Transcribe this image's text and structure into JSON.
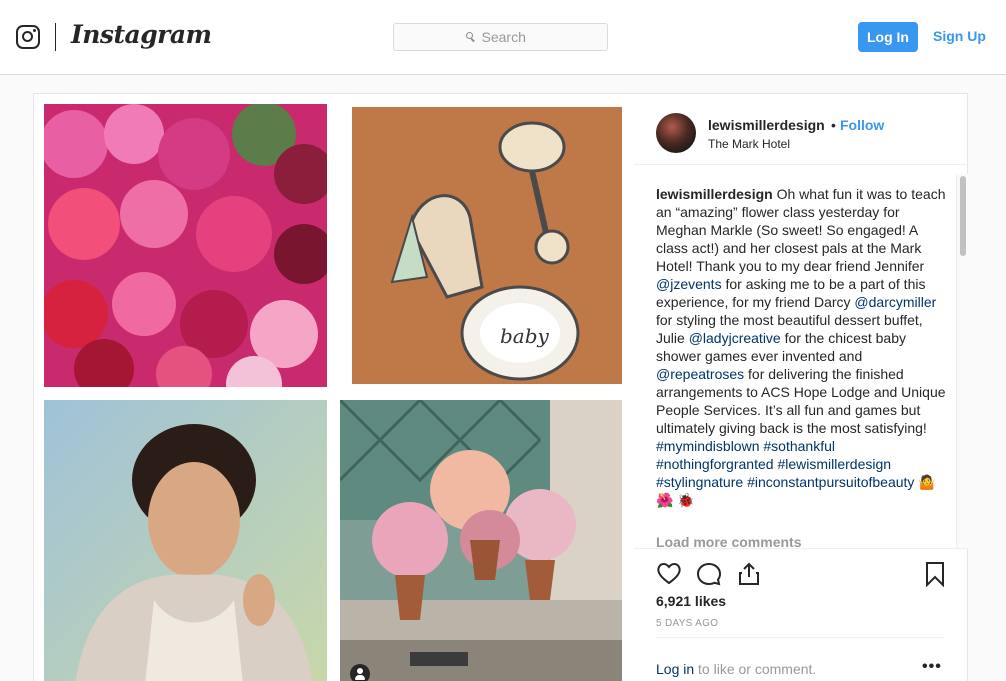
{
  "header": {
    "brand": "Instagram",
    "search_placeholder": "Search",
    "login_label": "Log In",
    "signup_label": "Sign Up"
  },
  "post": {
    "author": "lewismillerdesign",
    "separator": "•",
    "follow_label": "Follow",
    "location": "The Mark Hotel",
    "caption_parts": [
      {
        "type": "user",
        "text": "lewismillerdesign"
      },
      {
        "type": "text",
        "text": " Oh what fun it was to teach an “amazing” flower class yesterday for Meghan Markle (So sweet! So engaged! A class act!) and her closest pals at the Mark Hotel! Thank you to my dear friend Jennifer "
      },
      {
        "type": "mention",
        "text": "@jzevents"
      },
      {
        "type": "text",
        "text": " for asking me to be a part of this experience, for my friend Darcy "
      },
      {
        "type": "mention",
        "text": "@darcymiller"
      },
      {
        "type": "text",
        "text": " for styling the most beautiful dessert buffet, Julie "
      },
      {
        "type": "mention",
        "text": "@ladyjcreative"
      },
      {
        "type": "text",
        "text": " for the chicest baby shower games ever invented and "
      },
      {
        "type": "mention",
        "text": "@repeatroses"
      },
      {
        "type": "text",
        "text": " for delivering the finished arrangements to ACS Hope Lodge and Unique People Services. It’s all fun and games but ultimately giving back is the most satisfying! "
      },
      {
        "type": "mention",
        "text": "#mymindisblown"
      },
      {
        "type": "text",
        "text": " "
      },
      {
        "type": "mention",
        "text": "#sothankful"
      },
      {
        "type": "text",
        "text": " "
      },
      {
        "type": "mention",
        "text": "#nothingforgranted"
      },
      {
        "type": "text",
        "text": " "
      },
      {
        "type": "mention",
        "text": "#lewismillerdesign"
      },
      {
        "type": "text",
        "text": " "
      },
      {
        "type": "mention",
        "text": "#stylingnature"
      },
      {
        "type": "text",
        "text": " "
      },
      {
        "type": "mention",
        "text": "#inconstantpursuitofbeauty"
      },
      {
        "type": "text",
        "text": " 🤷 🌺 🐞"
      }
    ],
    "load_more_label": "Load more comments",
    "likes": "6,921 likes",
    "timestamp": "5 DAYS AGO",
    "login_prompt_link": "Log in",
    "login_prompt_rest": " to like or comment.",
    "options_label": "•••",
    "photo_text": "baby"
  },
  "icons": {
    "brand_glyph": "instagram-camera-icon",
    "search": "search-icon",
    "like": "heart-icon",
    "comment": "speech-bubble-icon",
    "share": "share-icon",
    "save": "bookmark-icon",
    "tag": "user-tag-icon"
  },
  "colors": {
    "accent": "#3897f0",
    "mention": "#003569",
    "muted": "#999999",
    "text": "#262626",
    "border": "#dbdbdb"
  }
}
